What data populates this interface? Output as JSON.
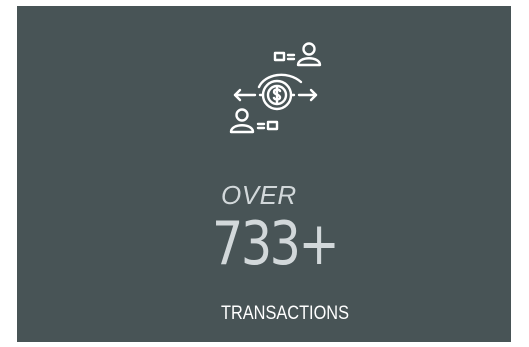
{
  "stat": {
    "icon": "money-transfer-icon",
    "prefix": "OVER",
    "value": "733+",
    "label": "TRANSACTIONS"
  },
  "colors": {
    "card_background": "#485456",
    "icon": "#ffffff",
    "number": "#d2d8da",
    "label": "#ffffff"
  }
}
